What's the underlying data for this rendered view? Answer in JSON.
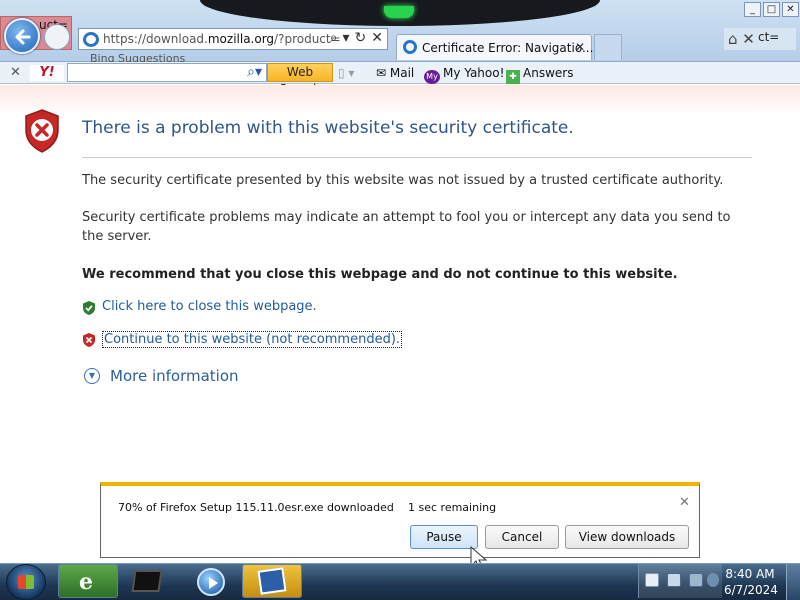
{
  "browser": {
    "address_url_prefix": "https://download.",
    "address_url_domain": "mozilla.org",
    "address_url_rest": "/?product=",
    "address_suggestions": "Bing Suggestions",
    "tab_title": "Certificate Error: Navigatio...",
    "left_thumbnail_text": "uct=",
    "right_thumbnail_text": "ct=",
    "window_controls": [
      "_",
      "□",
      "✕"
    ]
  },
  "yahoo_toolbar": {
    "logo": "Y!",
    "search_placeholder": "",
    "search_button": "Web Search",
    "mail": "Mail",
    "my_yahoo_icon": "My",
    "my_yahoo": "My Yahoo!",
    "answers": "Answers"
  },
  "page": {
    "title": "There is a problem with this website's security certificate.",
    "paragraph_1": "The security certificate presented by this website was not issued by a trusted certificate authority.",
    "paragraph_2": "Security certificate problems may indicate an attempt to fool you or intercept any data you send to the server.",
    "recommendation": "We recommend that you close this webpage and do not continue to this website.",
    "close_link": "Click here to close this webpage.",
    "continue_link": "Continue to this website (not recommended).",
    "more_info": "More information"
  },
  "download": {
    "status_text": "70% of Firefox Setup 115.11.0esr.exe downloaded",
    "progress_percent": 70,
    "time_remaining": "1 sec remaining",
    "pause_label": "Pause",
    "cancel_label": "Cancel",
    "view_label": "View downloads"
  },
  "taskbar": {
    "time": "8:40 AM",
    "date": "6/7/2024",
    "apps": [
      "internet-explorer",
      "terminal",
      "windows-media-player",
      "setup-installer"
    ]
  },
  "colors": {
    "title_blue": "#30558a",
    "link_blue": "#1f5c9a",
    "download_accent": "#f0b400",
    "error_red": "#c62828",
    "ok_green": "#2e7d32"
  }
}
